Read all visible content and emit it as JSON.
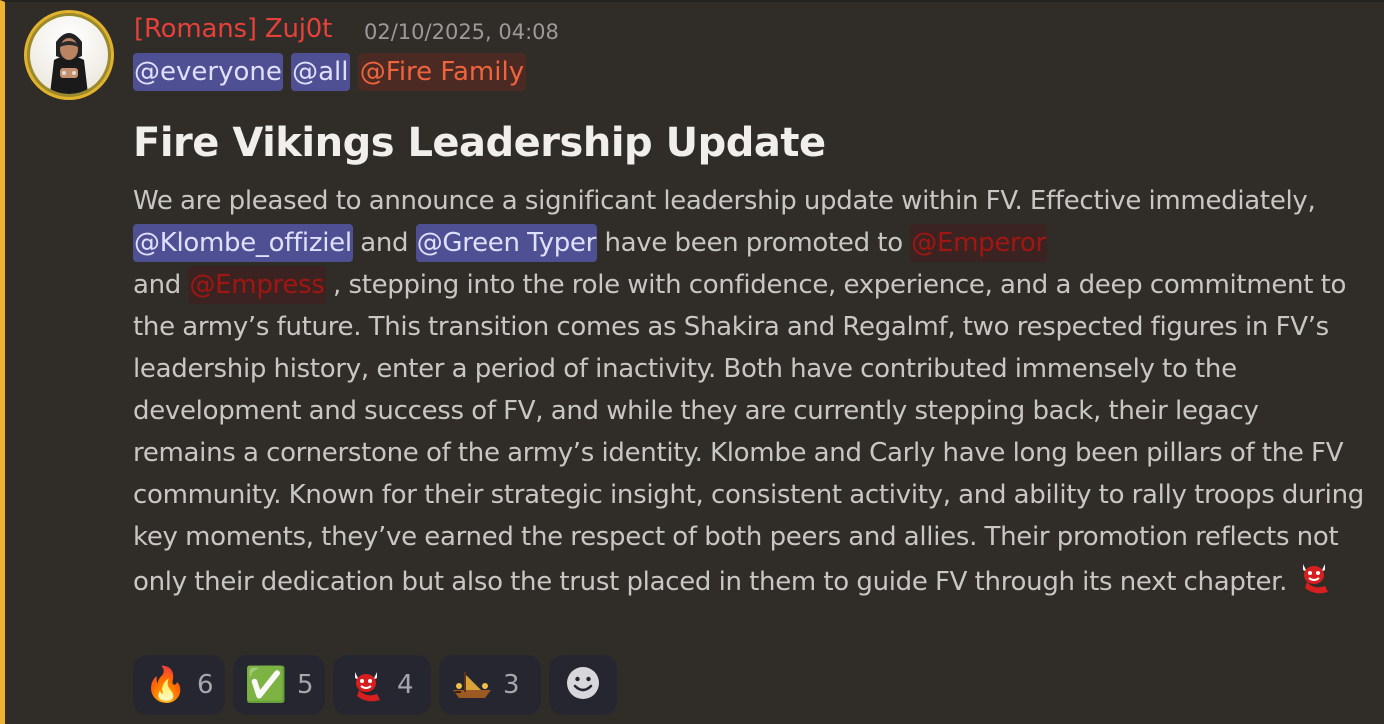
{
  "message": {
    "author": "[Romans] Zuj0t",
    "timestamp": "02/10/2025, 04:08",
    "mentions": {
      "everyone": "@everyone",
      "all": "@all",
      "fire_family": "@Fire Family"
    },
    "heading": "Fire Vikings Leadership Update",
    "body": {
      "part1": "We are pleased to announce a significant leadership update within FV. Effective immediately, ",
      "mention_klombe": "@Klombe_offiziel",
      "part2": " and ",
      "mention_green": "@Green Typer",
      "part3": " have been promoted to ",
      "mention_emperor": "@Emperor",
      "part4": " and ",
      "mention_empress": "@Empress",
      "part5": " , stepping into the role with confidence, experience, and a deep commitment to the army’s future. This transition comes as Shakira and Regalmf, two respected figures in FV’s leadership history, enter a period of inactivity. Both have contributed immensely to the development and success of FV, and while they are currently stepping back, their legacy remains a cornerstone of the army’s identity. Klombe and Carly have long been pillars of the FV community. Known for their strategic insight, consistent activity, and ability to rally troops during key moments, they’ve earned the respect of both peers and allies. Their promotion reflects not only their dedication but also the trust placed in them to guide FV through its next chapter. "
    },
    "inline_emoji": "red-devil-emoji",
    "reactions": [
      {
        "emoji": "fire-emoji",
        "glyph": "🔥",
        "count": "6"
      },
      {
        "emoji": "check-mark-emoji",
        "glyph": "✅",
        "count": "5"
      },
      {
        "emoji": "red-devil-emoji",
        "count": "4"
      },
      {
        "emoji": "viking-ship-emoji",
        "count": "3"
      }
    ],
    "add_reaction_icon": "smiley-add-reaction-icon"
  },
  "colors": {
    "accent_bar": "#f0b232",
    "author": "#e5403a",
    "mention_bg": "#4f5093",
    "fire_role": "#f0643d",
    "dark_role": "#a11612"
  }
}
